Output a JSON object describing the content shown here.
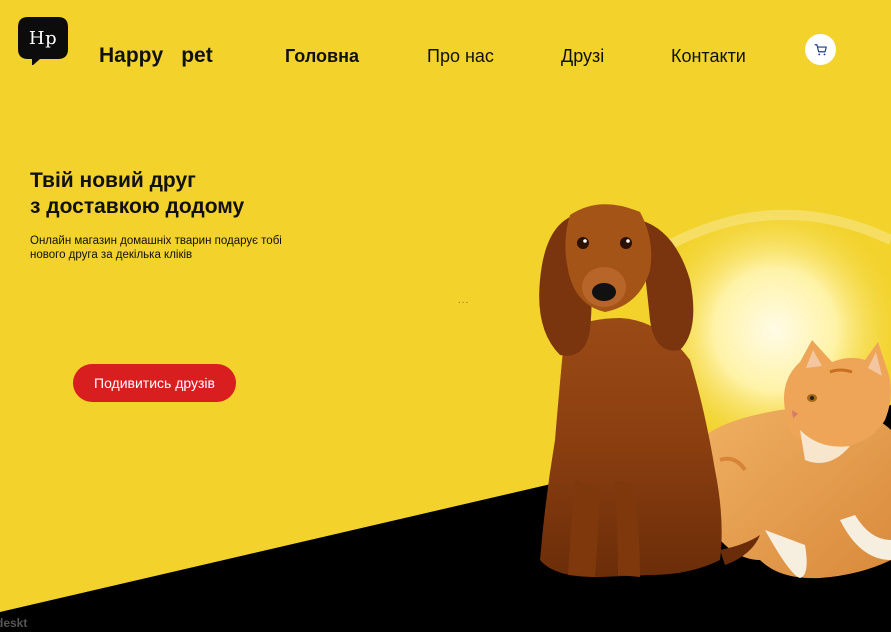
{
  "brand": {
    "logo_mark": "Hp",
    "name_part1": "Happy",
    "name_part2": "pet"
  },
  "nav": {
    "items": [
      {
        "label": "Головна",
        "active": true
      },
      {
        "label": "Про нас",
        "active": false
      },
      {
        "label": "Друзі",
        "active": false
      },
      {
        "label": "Контакти",
        "active": false
      }
    ]
  },
  "cart": {
    "icon": "cart-icon"
  },
  "hero": {
    "title_line1": "Твій новий друг",
    "title_line2": "з доставкою додому",
    "subtitle_line1": "Онлайн магазин домашніх тварин подарує тобі",
    "subtitle_line2": "нового друга за декілька кліків",
    "dots": "...",
    "cta_label": "Подивитись друзів"
  },
  "footer": {
    "tag": "deskt"
  },
  "colors": {
    "background": "#f2d22b",
    "dark": "#000000",
    "accent": "#d81e1e",
    "text": "#111111"
  }
}
